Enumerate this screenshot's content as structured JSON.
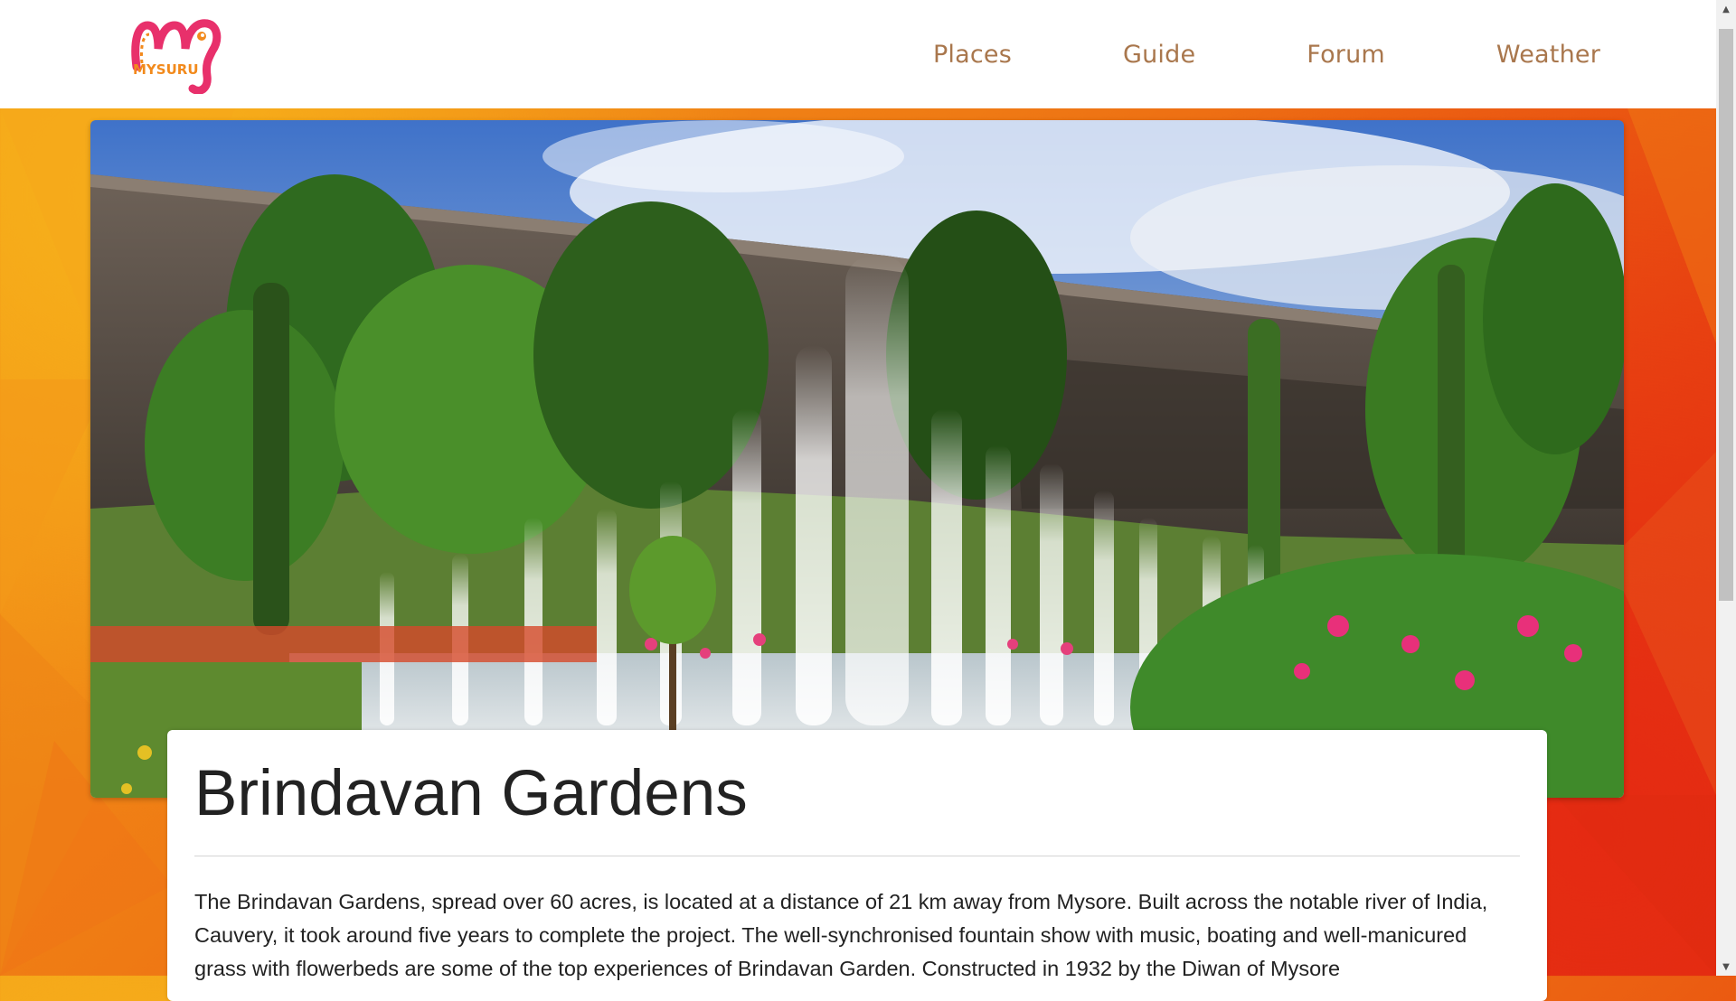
{
  "brand": {
    "logo_text": "MYSURU",
    "colors": {
      "pink": "#e8306b",
      "orange": "#f28a1c",
      "nav_text": "#a9774d"
    }
  },
  "nav": {
    "items": [
      {
        "label": "Places"
      },
      {
        "label": "Guide"
      },
      {
        "label": "Forum"
      },
      {
        "label": "Weather"
      }
    ]
  },
  "hero": {
    "icon": "brindavan-gardens-photo"
  },
  "article": {
    "title": "Brindavan Gardens",
    "body": "The Brindavan Gardens, spread over 60 acres, is located at a distance of 21 km away from Mysore. Built across the notable river of India, Cauvery, it took around five years to complete the project. The well-synchronised fountain show with music, boating and well-manicured grass with flowerbeds are some of the top experiences of Brindavan Garden. Constructed in 1932 by the Diwan of Mysore"
  },
  "background": {
    "colors": [
      "#f7b21a",
      "#ef7a14",
      "#e94d10",
      "#e0320f"
    ]
  }
}
